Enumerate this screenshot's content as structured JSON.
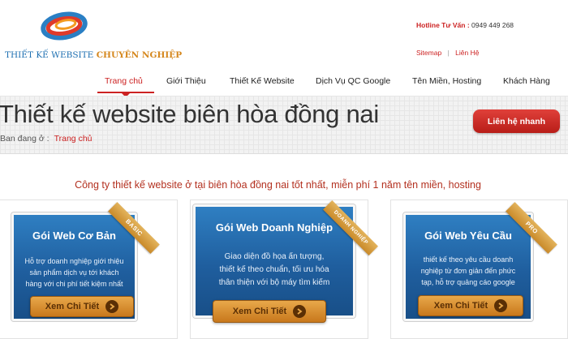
{
  "header": {
    "logo_text_a": "THIẾT KẾ WEBSITE",
    "logo_text_b": "CHUYÊN NGHIỆP",
    "hotline_label": "Hotline Tư Vấn :",
    "hotline_number": "0949 449 268",
    "sitemap": "Sitemap",
    "separator": "|",
    "contact": "Liên Hệ"
  },
  "nav": {
    "items": [
      {
        "label": "Trang chủ"
      },
      {
        "label": "Giới Thiệu"
      },
      {
        "label": "Thiết Kế Website"
      },
      {
        "label": "Dịch Vụ QC Google"
      },
      {
        "label": "Tên Miền, Hosting"
      },
      {
        "label": "Khách Hàng"
      }
    ]
  },
  "banner": {
    "title": "Thiết kế website biên hòa đồng nai",
    "breadcrumb_label": "Ban đang ở :",
    "breadcrumb_link": "Trang chủ",
    "contact_button": "Liên hệ nhanh"
  },
  "intro": "Công ty thiết kế website ở tại biên hòa đồng nai tốt nhất, miễn phí 1 năm tên miền, hosting",
  "cards": [
    {
      "title": "Gói Web Cơ Bản",
      "ribbon": "BASIC",
      "desc": [
        "Hỗ trợ doanh nghiệp giới thiệu",
        "sản phẩm dịch vụ tới khách",
        "hàng với chi phí tiết kiệm nhất"
      ],
      "button": "Xem Chi Tiết"
    },
    {
      "title": "Gói Web Doanh Nghiệp",
      "ribbon": "DOANH NGHIỆP",
      "desc": [
        "Giao diện đồ họa ấn tượng,",
        "thiết kế theo chuẩn, tối ưu hóa",
        "thân thiện với bộ máy tìm kiếm"
      ],
      "button": "Xem Chi Tiết"
    },
    {
      "title": "Gói Web Yêu Cầu",
      "ribbon": "PRO",
      "desc": [
        "thiết kế theo yêu cầu doanh",
        "nghiệp từ đơn giản đến phức",
        "tạp, hỗ trợ quảng cáo google"
      ],
      "button": "Xem Chi Tiết"
    }
  ],
  "colors": {
    "accent": "#cc2222",
    "card_blue": "#1f5e9e",
    "button_orange": "#d88f33"
  }
}
